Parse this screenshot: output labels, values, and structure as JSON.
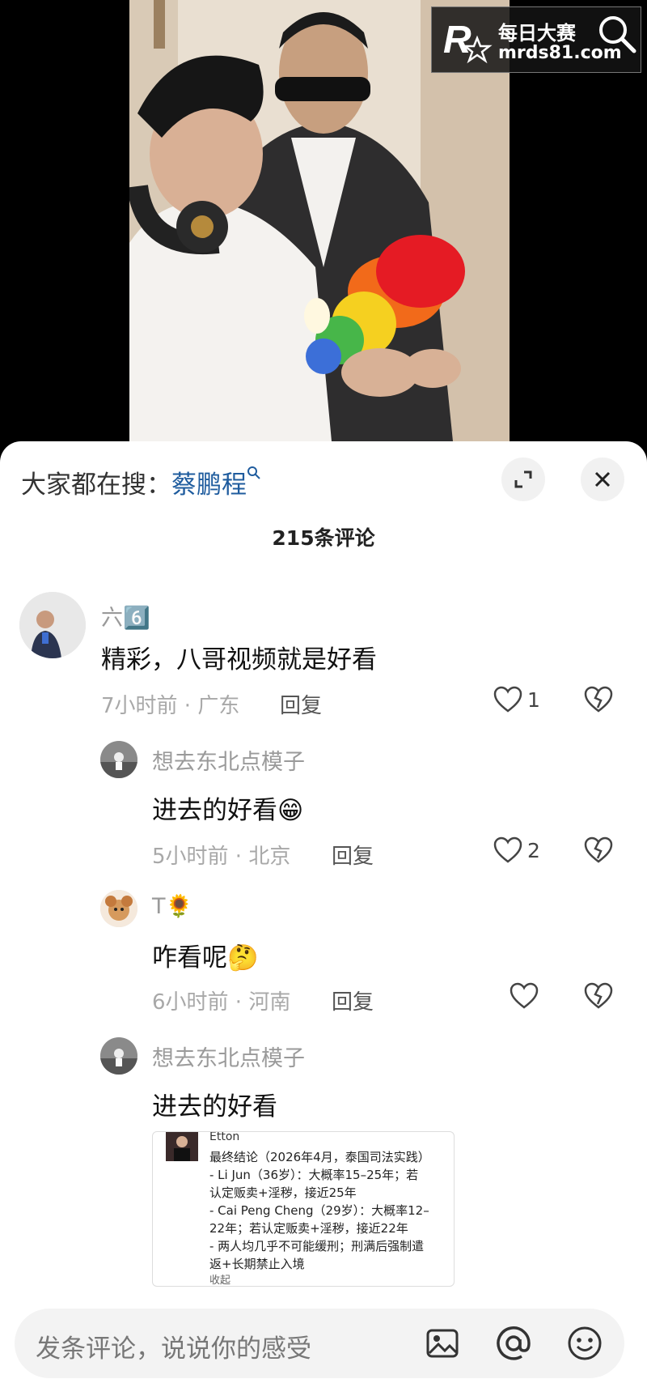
{
  "watermark": {
    "brand_cn": "每日大赛",
    "url": "mrds81.com",
    "logo_letter": "R"
  },
  "panel": {
    "search_prefix": "大家都在搜：",
    "search_keyword": "蔡鹏程",
    "comment_count": "215条评论"
  },
  "comments": [
    {
      "user": "六6️⃣",
      "text": "精彩，八哥视频就是好看",
      "meta": "7小时前 · 广东",
      "reply": "回复",
      "likes": "1"
    },
    {
      "user": "想去东北点模子",
      "text": "进去的好看😁",
      "meta": "5小时前 · 北京",
      "reply": "回复",
      "likes": "2"
    },
    {
      "user": "T🌻",
      "text": "咋看呢🤔",
      "meta": "6小时前 · 河南",
      "reply": "回复",
      "likes": ""
    },
    {
      "user": "想去东北点模子",
      "text": "进去的好看"
    }
  ],
  "embedded_shot": {
    "user": "Etton",
    "lines": [
      "最终结论（2026年4月，泰国司法实践）",
      "- Li Jun（36岁）：大概率15–25年；若",
      "认定贩卖+淫秽，接近25年",
      "- Cai Peng Cheng（29岁）：大概率12–",
      "22年；若认定贩卖+淫秽，接近22年",
      "- 两人均几乎不可能缓刑；刑满后强制遣",
      "返+长期禁止入境"
    ],
    "collapse": "收起"
  },
  "input": {
    "placeholder": "发条评论，说说你的感受"
  },
  "icons": {
    "expand": "expand-icon",
    "close": "close-icon",
    "like": "heart-icon",
    "dislike": "broken-heart-icon",
    "image": "image-icon",
    "at": "at-icon",
    "emoji": "emoji-icon"
  }
}
